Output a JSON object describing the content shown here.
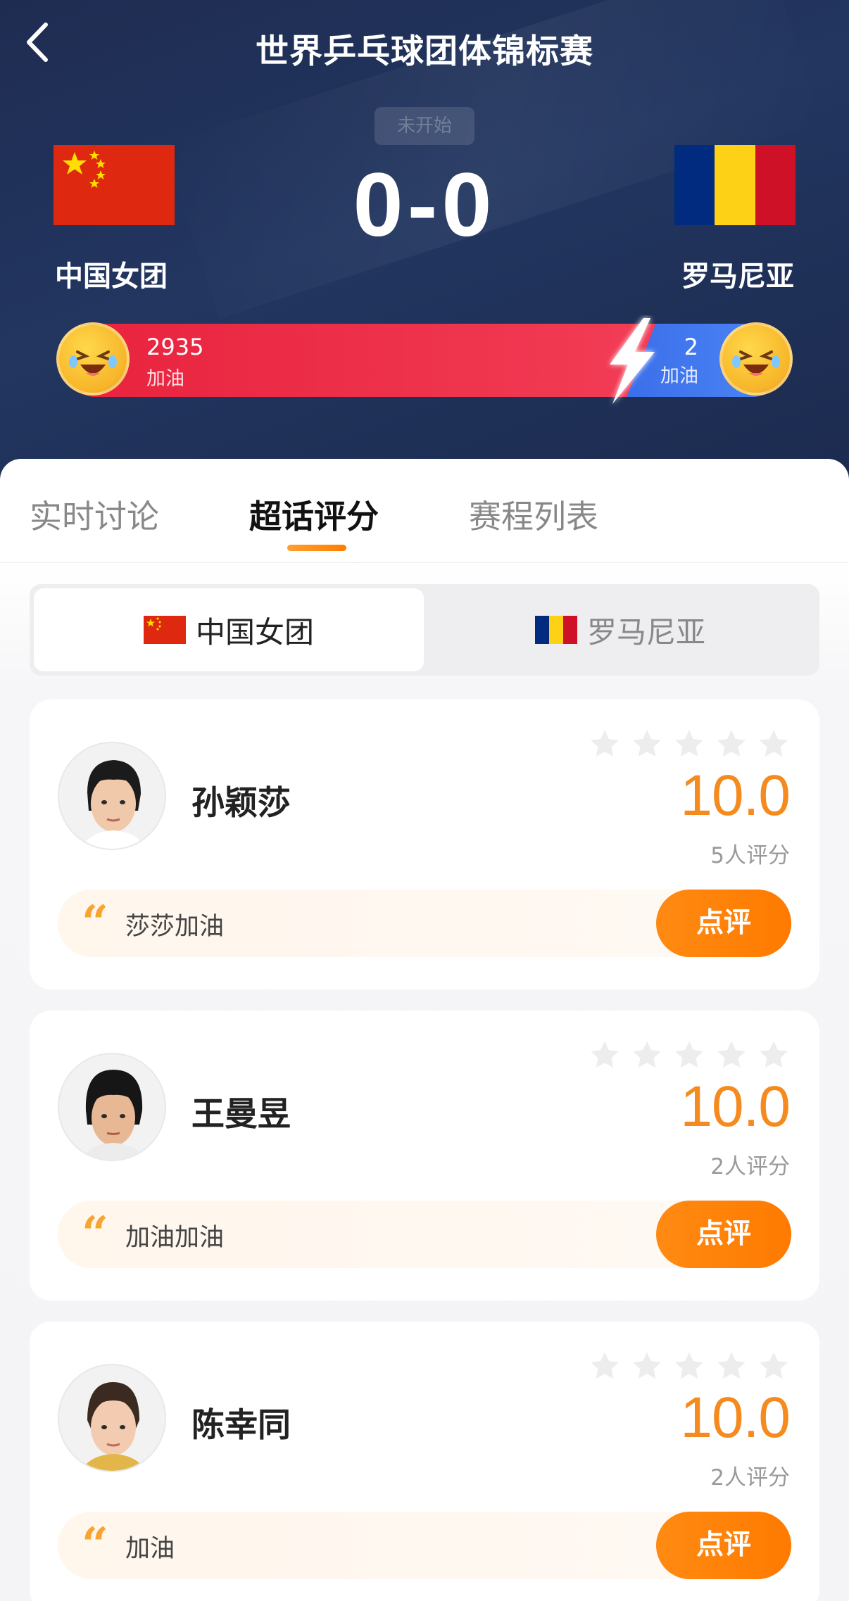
{
  "header": {
    "title": "世界乒乓球团体锦标赛",
    "status": "未开始",
    "score": "0-0",
    "home_team": "中国女团",
    "away_team": "罗马尼亚"
  },
  "support": {
    "home_count": "2935",
    "home_label": "加油",
    "away_count": "2",
    "away_label": "加油"
  },
  "tabs": [
    {
      "label": "实时讨论"
    },
    {
      "label": "超话评分"
    },
    {
      "label": "赛程列表"
    }
  ],
  "team_toggle": {
    "home": "中国女团",
    "away": "罗马尼亚"
  },
  "players": [
    {
      "name": "孙颖莎",
      "rating": "10.0",
      "count": "5人评分",
      "comment": "莎莎加油",
      "button": "点评",
      "stars": 0
    },
    {
      "name": "王曼昱",
      "rating": "10.0",
      "count": "2人评分",
      "comment": "加油加油",
      "button": "点评",
      "stars": 0
    },
    {
      "name": "陈幸同",
      "rating": "10.0",
      "count": "2人评分",
      "comment": "加油",
      "button": "点评",
      "stars": 0
    }
  ],
  "colors": {
    "accent": "#f58a1f",
    "home_bar": "#e8223d",
    "away_bar": "#3b6fea",
    "china_red": "#de2910",
    "romania_blue": "#002b7f",
    "romania_yellow": "#fcd116",
    "romania_red": "#ce1126"
  }
}
